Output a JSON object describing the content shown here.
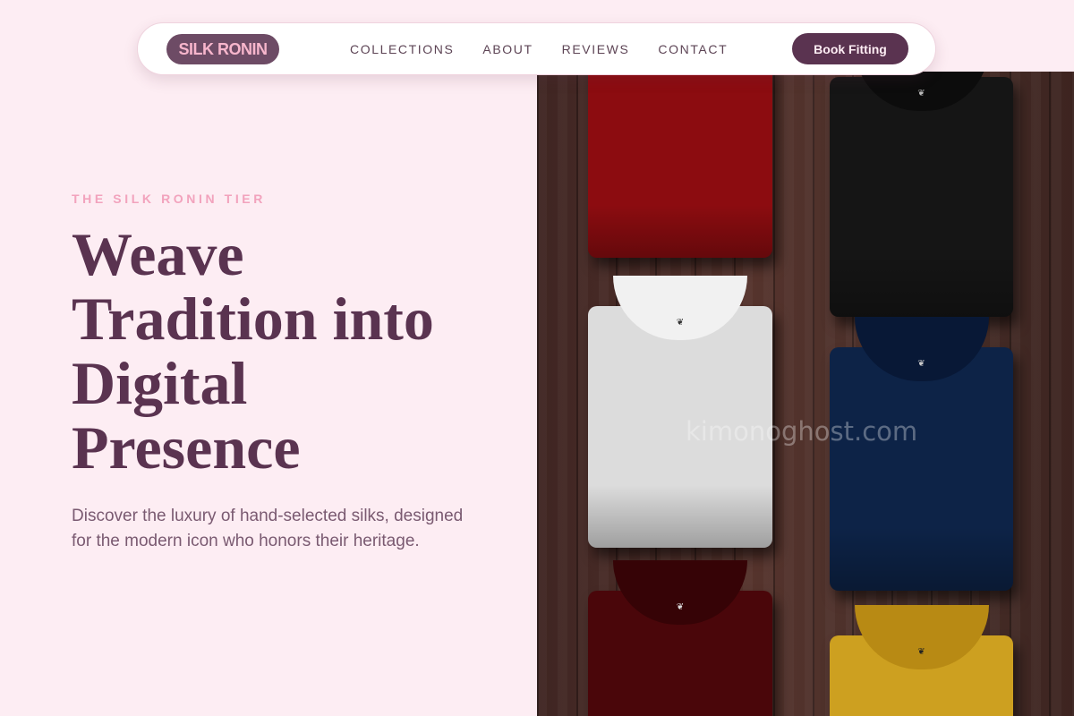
{
  "brand": {
    "logo_text": "SILK RONIN"
  },
  "nav": {
    "items": [
      "COLLECTIONS",
      "ABOUT",
      "REVIEWS",
      "CONTACT"
    ],
    "cta_label": "Book Fitting"
  },
  "hero": {
    "eyebrow": "THE SILK RONIN TIER",
    "headline_lines": [
      "Weave",
      "Tradition into",
      "Digital",
      "Presence"
    ],
    "subtext": "Discover the luxury of hand-selected silks, designed for the modern icon who honors their heritage.",
    "image": {
      "subject": "folded t-shirts on dark wooden planks",
      "shirt_colors": [
        "red",
        "black",
        "white",
        "navy",
        "maroon",
        "mustard"
      ],
      "tag_icon": "logo-tag-icon"
    }
  },
  "watermark": "kimonoghost.com",
  "colors": {
    "background": "#fdedf3",
    "accent": "#5a3350",
    "eyebrow": "#f2a3bd",
    "logo_bg": "#6d4b65",
    "logo_text": "#f7b6cc"
  }
}
